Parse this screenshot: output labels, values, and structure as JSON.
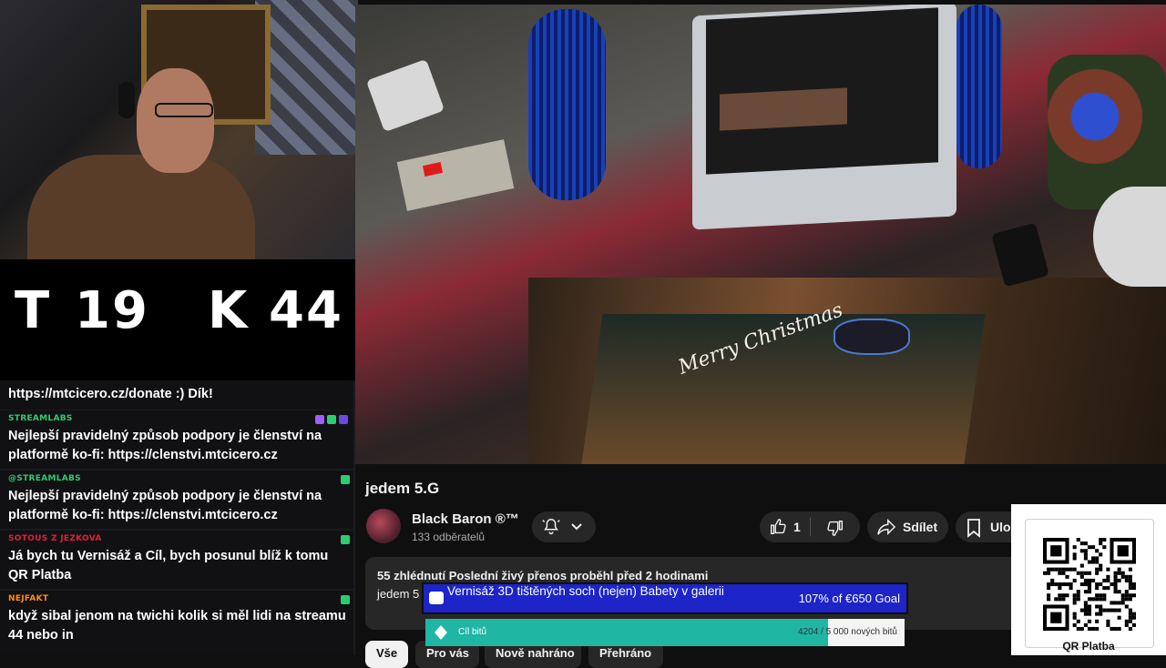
{
  "counter": {
    "t_label": "T",
    "t_value": "19",
    "k_label": "K",
    "k_value": "44"
  },
  "chat": {
    "messages": [
      {
        "user": "",
        "text": "https://mtcicero.cz/donate :) Dík!"
      },
      {
        "user": "STREAMLABS",
        "user_color": "#2ecc71",
        "text": "Nejlepší pravidelný způsob podpory je členství na platformě ko-fi: https://clenstvi.mtcicero.cz"
      },
      {
        "user": "@STREAMLABS",
        "user_color": "#2ecc71",
        "text": "Nejlepší pravidelný způsob podpory je členství na platformě ko-fi: https://clenstvi.mtcicero.cz"
      },
      {
        "user": "SOTOUS Z JEZKOVA",
        "user_color": "#e0203a",
        "text": "Já bych tu Vernisáž a Cíl, bych posunul blíž k tomu QR Platba"
      },
      {
        "user": "NEJFAKT",
        "user_color": "#ff8a1a",
        "text": "když sibal jenom na twichi kolik si měl lidi na streamu 44 nebo in"
      }
    ]
  },
  "video": {
    "mat_text": "Merry Christmas"
  },
  "youtube": {
    "title": "jedem 5.G",
    "channel_name": "Black Baron ®™",
    "subscribers": "133 odběratelů",
    "likes": "1",
    "share_label": "Sdílet",
    "save_label": "Ulož",
    "desc_stats": "55 zhlédnutí  Poslední živý přenos proběhl před 2 hodinami",
    "desc_line": "jedem 5",
    "chips": [
      "Vše",
      "Pro vás",
      "Nově nahráno",
      "Přehráno"
    ]
  },
  "goals": {
    "vernisaz_text": "Vernisáž 3D tištěných soch (nejen) Babety v galerii",
    "vernisaz_value": "107% of €650 Goal",
    "bits_label": "Cíl bitů",
    "bits_value": "4204 / 5 000 nových bitů",
    "bits_progress": 0.8408
  },
  "qr": {
    "label": "QR Platba"
  },
  "colors": {
    "bg": "#0f0f0f",
    "pill": "#272727",
    "goal_blue": "#1d24c8",
    "goal_teal": "#1fb6a4"
  }
}
